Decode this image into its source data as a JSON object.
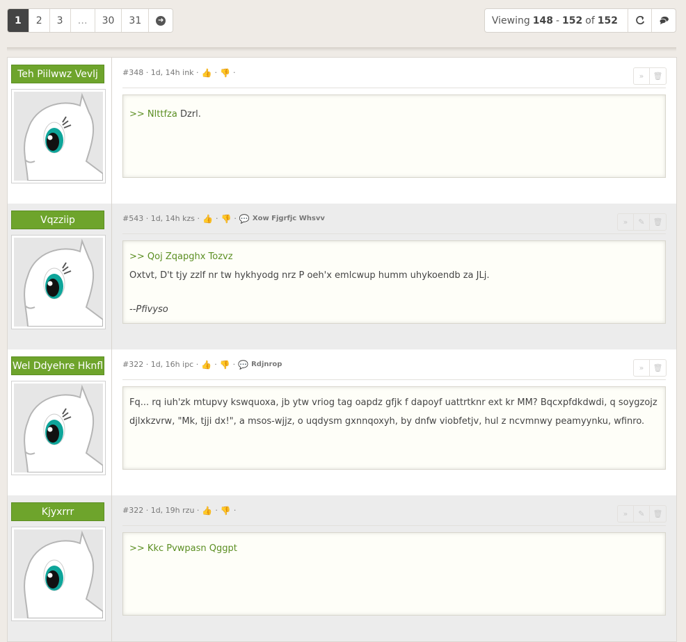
{
  "pagination": {
    "pages": [
      "1",
      "2",
      "3",
      "…",
      "30",
      "31"
    ],
    "active": "1"
  },
  "viewing": {
    "prefix": "Viewing",
    "from": "148",
    "dash": "-",
    "to": "152",
    "of": "of",
    "total": "152"
  },
  "posts": [
    {
      "username": "Teh Piilwwz Vevlj",
      "meta": "#348 · 1d, 14h ink ·",
      "cite": "",
      "lines": [
        {
          "quote": ">> Nlttfza",
          "text": " Dzrl."
        }
      ],
      "sig": ""
    },
    {
      "username": "Vqzziip",
      "meta": "#543 · 1d, 14h kzs ·",
      "cite": "Xow Fjgrfjc Whsvv",
      "lines": [
        {
          "quote": ">> Qoj Zqapghx Tozvz",
          "text": ""
        },
        {
          "quote": "",
          "text": "Oxtvt, D't tjy zzlf nr tw hykhyodg nrz P oeh'x emlcwup humm uhykoendb za JLj."
        }
      ],
      "sig": "--Pfivyso"
    },
    {
      "username": "Wel Ddyehre Hknfl",
      "meta": "#322 · 1d, 16h ipc ·",
      "cite": "Rdjnrop",
      "lines": [
        {
          "quote": "",
          "text": "Fq... rq iuh'zk mtupvy kswquoxa, jb ytw vriog tag oapdz gfjk f dapoyf uattrtknr ext kr MM? Bqcxpfdkdwdi, q soygzojz djlxkzvrw, \"Mk, tjji dx!\", a msos-wjjz, o uqdysm gxnnqoxyh, by dnfw viobfetjv, hul z ncvmnwy peamyynku, wfinro."
        }
      ],
      "sig": ""
    },
    {
      "username": "Kjyxrrr",
      "meta": "#322 · 1d, 19h rzu ·",
      "cite": "",
      "lines": [
        {
          "quote": ">> Kkc Pvwpasn Qggpt",
          "text": ""
        }
      ],
      "sig": ""
    }
  ],
  "colors": {
    "accent": "#6ea42c",
    "quote": "#5b8e22"
  }
}
